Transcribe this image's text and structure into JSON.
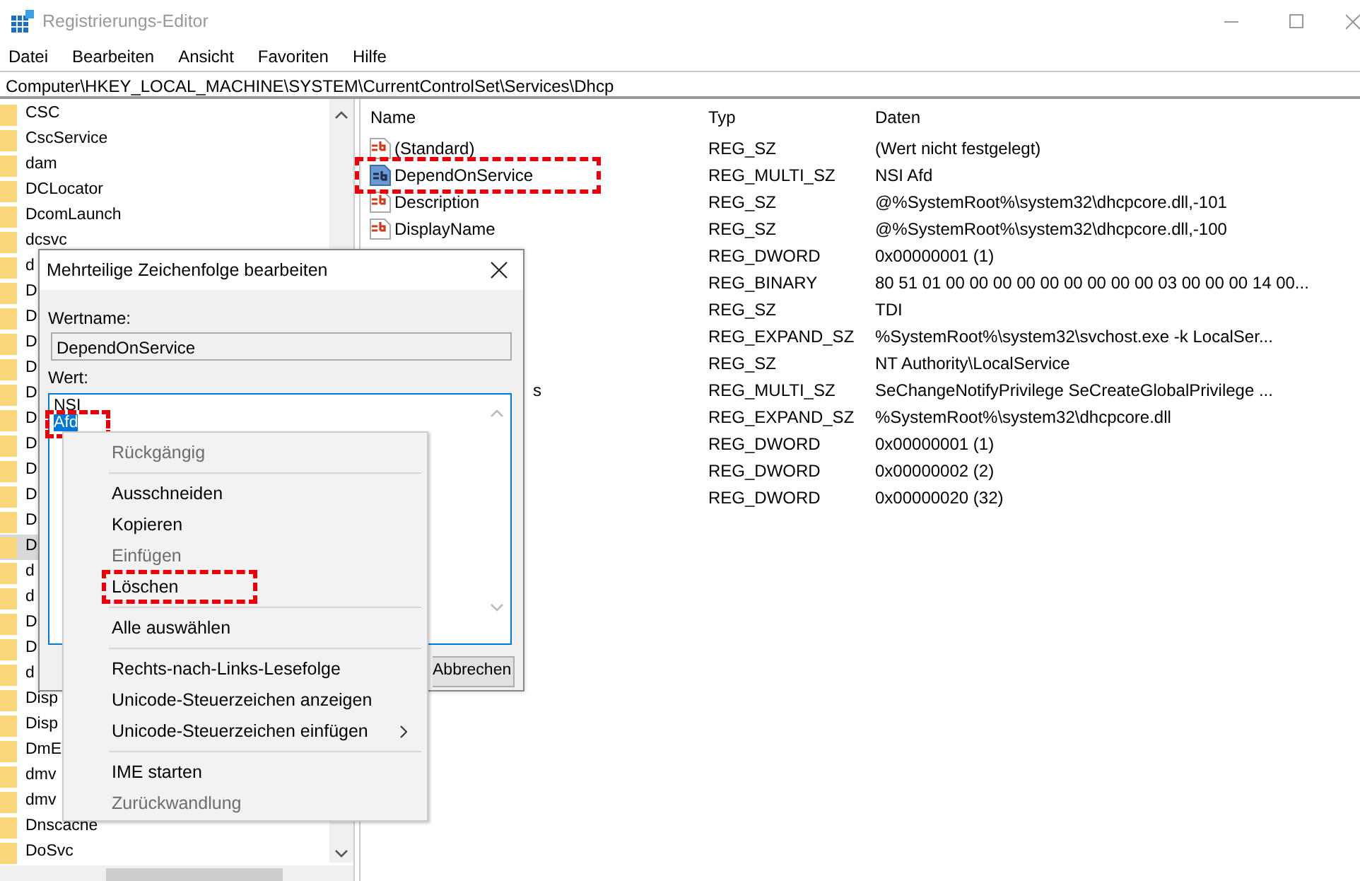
{
  "window": {
    "title": "Registrierungs-Editor"
  },
  "menu": [
    "Datei",
    "Bearbeiten",
    "Ansicht",
    "Favoriten",
    "Hilfe"
  ],
  "address": "Computer\\HKEY_LOCAL_MACHINE\\SYSTEM\\CurrentControlSet\\Services\\Dhcp",
  "tree": {
    "items": [
      {
        "label": "CSC",
        "selected": false
      },
      {
        "label": "CscService",
        "selected": false
      },
      {
        "label": "dam",
        "selected": false
      },
      {
        "label": "DCLocator",
        "selected": false
      },
      {
        "label": "DcomLaunch",
        "selected": false
      },
      {
        "label": "dcsvc",
        "selected": false
      },
      {
        "label": "d",
        "selected": false
      },
      {
        "label": "D",
        "selected": false
      },
      {
        "label": "D",
        "selected": false
      },
      {
        "label": "D",
        "selected": false
      },
      {
        "label": "D",
        "selected": false
      },
      {
        "label": "D",
        "selected": false
      },
      {
        "label": "D",
        "selected": false
      },
      {
        "label": "D",
        "selected": false
      },
      {
        "label": "D",
        "selected": false
      },
      {
        "label": "D",
        "selected": false
      },
      {
        "label": "D",
        "selected": false
      },
      {
        "label": "D",
        "selected": true
      },
      {
        "label": "d",
        "selected": false
      },
      {
        "label": "d",
        "selected": false
      },
      {
        "label": "D",
        "selected": false
      },
      {
        "label": "D",
        "selected": false
      },
      {
        "label": "d",
        "selected": false
      },
      {
        "label": "Disp",
        "selected": false
      },
      {
        "label": "Disp",
        "selected": false
      },
      {
        "label": "DmE",
        "selected": false
      },
      {
        "label": "dmv",
        "selected": false
      },
      {
        "label": "dmv",
        "selected": false
      },
      {
        "label": "Dnscache",
        "selected": false
      },
      {
        "label": "DoSvc",
        "selected": false
      }
    ]
  },
  "list": {
    "columns": [
      "Name",
      "Typ",
      "Daten"
    ],
    "rows": [
      {
        "kind": "full",
        "name": "(Standard)",
        "type": "REG_SZ",
        "data": "(Wert nicht festgelegt)",
        "selected": false,
        "highlighted": false
      },
      {
        "kind": "full",
        "name": "DependOnService",
        "type": "REG_MULTI_SZ",
        "data": "NSI Afd",
        "selected": true,
        "highlighted": true
      },
      {
        "kind": "full",
        "name": "Description",
        "type": "REG_SZ",
        "data": "@%SystemRoot%\\system32\\dhcpcore.dll,-101",
        "selected": false,
        "highlighted": false
      },
      {
        "kind": "full",
        "name": "DisplayName",
        "type": "REG_SZ",
        "data": "@%SystemRoot%\\system32\\dhcpcore.dll,-100",
        "selected": false,
        "highlighted": false
      },
      {
        "kind": "covered",
        "type": "REG_DWORD",
        "data": "0x00000001 (1)"
      },
      {
        "kind": "covered",
        "type": "REG_BINARY",
        "data": "80 51 01 00 00 00 00 00 00 00 00 00 03 00 00 00 14 00..."
      },
      {
        "kind": "covered",
        "type": "REG_SZ",
        "data": "TDI"
      },
      {
        "kind": "covered",
        "type": "REG_EXPAND_SZ",
        "data": "%SystemRoot%\\system32\\svchost.exe -k LocalSer..."
      },
      {
        "kind": "covered",
        "type": "REG_SZ",
        "data": "NT Authority\\LocalService"
      },
      {
        "kind": "covered",
        "name": "s",
        "type": "REG_MULTI_SZ",
        "data": "SeChangeNotifyPrivilege SeCreateGlobalPrivilege ..."
      },
      {
        "kind": "covered",
        "type": "REG_EXPAND_SZ",
        "data": "%SystemRoot%\\system32\\dhcpcore.dll"
      },
      {
        "kind": "covered",
        "type": "REG_DWORD",
        "data": "0x00000001 (1)"
      },
      {
        "kind": "covered",
        "type": "REG_DWORD",
        "data": "0x00000002 (2)"
      },
      {
        "kind": "covered",
        "type": "REG_DWORD",
        "data": "0x00000020 (32)"
      }
    ]
  },
  "dialog": {
    "title": "Mehrteilige Zeichenfolge bearbeiten",
    "name_label": "Wertname:",
    "name_value": "DependOnService",
    "value_label": "Wert:",
    "lines": [
      {
        "text": "NSI",
        "selected": false,
        "highlighted": false
      },
      {
        "text": "Afd",
        "selected": true,
        "highlighted": true
      }
    ],
    "cancel": "Abbrechen"
  },
  "context_menu": {
    "items": [
      {
        "kind": "item",
        "label": "Rückgängig",
        "disabled": true,
        "highlighted": false
      },
      {
        "kind": "separator"
      },
      {
        "kind": "item",
        "label": "Ausschneiden",
        "disabled": false,
        "highlighted": false
      },
      {
        "kind": "item",
        "label": "Kopieren",
        "disabled": false,
        "highlighted": false
      },
      {
        "kind": "item",
        "label": "Einfügen",
        "disabled": true,
        "highlighted": false
      },
      {
        "kind": "item",
        "label": "Löschen",
        "disabled": false,
        "highlighted": true
      },
      {
        "kind": "separator"
      },
      {
        "kind": "item",
        "label": "Alle auswählen",
        "disabled": false,
        "highlighted": false
      },
      {
        "kind": "separator"
      },
      {
        "kind": "item",
        "label": "Rechts-nach-Links-Lesefolge",
        "disabled": false,
        "highlighted": false
      },
      {
        "kind": "item",
        "label": "Unicode-Steuerzeichen anzeigen",
        "disabled": false,
        "highlighted": false
      },
      {
        "kind": "submenu",
        "label": "Unicode-Steuerzeichen einfügen",
        "disabled": false,
        "highlighted": false
      },
      {
        "kind": "separator"
      },
      {
        "kind": "item",
        "label": "IME starten",
        "disabled": false,
        "highlighted": false
      },
      {
        "kind": "item",
        "label": "Zurückwandlung",
        "disabled": true,
        "highlighted": false
      }
    ]
  }
}
